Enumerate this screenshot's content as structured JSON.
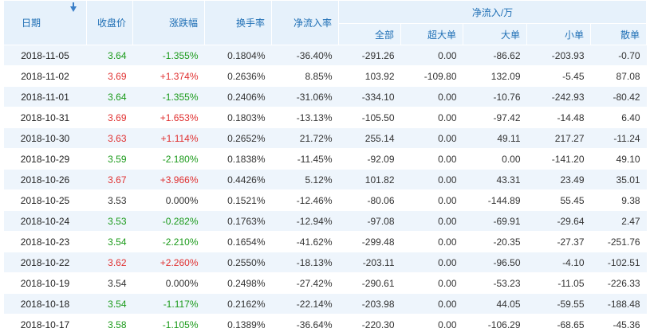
{
  "colors": {
    "up": "#e03030",
    "down": "#1a9a1a",
    "header_text": "#1f6fb5",
    "header_bg": "#e6f1fb",
    "stripe": "#eef5fc"
  },
  "header": {
    "date": "日期",
    "sort_icon": "sort-down-arrow-icon",
    "close": "收盘价",
    "change_pct": "涨跌幅",
    "turnover": "换手率",
    "net_inflow_rate": "净流入率",
    "net_inflow_group": "净流入/万",
    "sub": [
      "全部",
      "超大单",
      "大单",
      "小单",
      "散单"
    ]
  },
  "rows": [
    {
      "date": "2018-11-05",
      "close": "3.64",
      "change": "-1.355%",
      "dir": "down",
      "turnover": "0.1804%",
      "rate": "-36.40%",
      "all": "-291.26",
      "xl": "0.00",
      "large": "-86.62",
      "small": "-203.93",
      "retail": "-0.70"
    },
    {
      "date": "2018-11-02",
      "close": "3.69",
      "change": "+1.374%",
      "dir": "up",
      "turnover": "0.2636%",
      "rate": "8.85%",
      "all": "103.92",
      "xl": "-109.80",
      "large": "132.09",
      "small": "-5.45",
      "retail": "87.08"
    },
    {
      "date": "2018-11-01",
      "close": "3.64",
      "change": "-1.355%",
      "dir": "down",
      "turnover": "0.2406%",
      "rate": "-31.06%",
      "all": "-334.10",
      "xl": "0.00",
      "large": "-10.76",
      "small": "-242.93",
      "retail": "-80.42"
    },
    {
      "date": "2018-10-31",
      "close": "3.69",
      "change": "+1.653%",
      "dir": "up",
      "turnover": "0.1803%",
      "rate": "-13.13%",
      "all": "-105.50",
      "xl": "0.00",
      "large": "-97.42",
      "small": "-14.48",
      "retail": "6.40"
    },
    {
      "date": "2018-10-30",
      "close": "3.63",
      "change": "+1.114%",
      "dir": "up",
      "turnover": "0.2652%",
      "rate": "21.72%",
      "all": "255.14",
      "xl": "0.00",
      "large": "49.11",
      "small": "217.27",
      "retail": "-11.24"
    },
    {
      "date": "2018-10-29",
      "close": "3.59",
      "change": "-2.180%",
      "dir": "down",
      "turnover": "0.1838%",
      "rate": "-11.45%",
      "all": "-92.09",
      "xl": "0.00",
      "large": "0.00",
      "small": "-141.20",
      "retail": "49.10"
    },
    {
      "date": "2018-10-26",
      "close": "3.67",
      "change": "+3.966%",
      "dir": "up",
      "turnover": "0.4426%",
      "rate": "5.12%",
      "all": "101.82",
      "xl": "0.00",
      "large": "43.31",
      "small": "23.49",
      "retail": "35.01"
    },
    {
      "date": "2018-10-25",
      "close": "3.53",
      "change": "0.000%",
      "dir": "flat",
      "turnover": "0.1521%",
      "rate": "-12.46%",
      "all": "-80.06",
      "xl": "0.00",
      "large": "-144.89",
      "small": "55.45",
      "retail": "9.38"
    },
    {
      "date": "2018-10-24",
      "close": "3.53",
      "change": "-0.282%",
      "dir": "down",
      "turnover": "0.1763%",
      "rate": "-12.94%",
      "all": "-97.08",
      "xl": "0.00",
      "large": "-69.91",
      "small": "-29.64",
      "retail": "2.47"
    },
    {
      "date": "2018-10-23",
      "close": "3.54",
      "change": "-2.210%",
      "dir": "down",
      "turnover": "0.1654%",
      "rate": "-41.62%",
      "all": "-299.48",
      "xl": "0.00",
      "large": "-20.35",
      "small": "-27.37",
      "retail": "-251.76"
    },
    {
      "date": "2018-10-22",
      "close": "3.62",
      "change": "+2.260%",
      "dir": "up",
      "turnover": "0.2550%",
      "rate": "-18.13%",
      "all": "-203.11",
      "xl": "0.00",
      "large": "-96.50",
      "small": "-4.10",
      "retail": "-102.51"
    },
    {
      "date": "2018-10-19",
      "close": "3.54",
      "change": "0.000%",
      "dir": "flat",
      "turnover": "0.2498%",
      "rate": "-27.42%",
      "all": "-290.61",
      "xl": "0.00",
      "large": "-53.23",
      "small": "-11.05",
      "retail": "-226.33"
    },
    {
      "date": "2018-10-18",
      "close": "3.54",
      "change": "-1.117%",
      "dir": "down",
      "turnover": "0.2162%",
      "rate": "-22.14%",
      "all": "-203.98",
      "xl": "0.00",
      "large": "44.05",
      "small": "-59.55",
      "retail": "-188.48"
    },
    {
      "date": "2018-10-17",
      "close": "3.58",
      "change": "-1.105%",
      "dir": "down",
      "turnover": "0.1389%",
      "rate": "-36.64%",
      "all": "-220.30",
      "xl": "0.00",
      "large": "-106.29",
      "small": "-68.65",
      "retail": "-45.36"
    }
  ]
}
